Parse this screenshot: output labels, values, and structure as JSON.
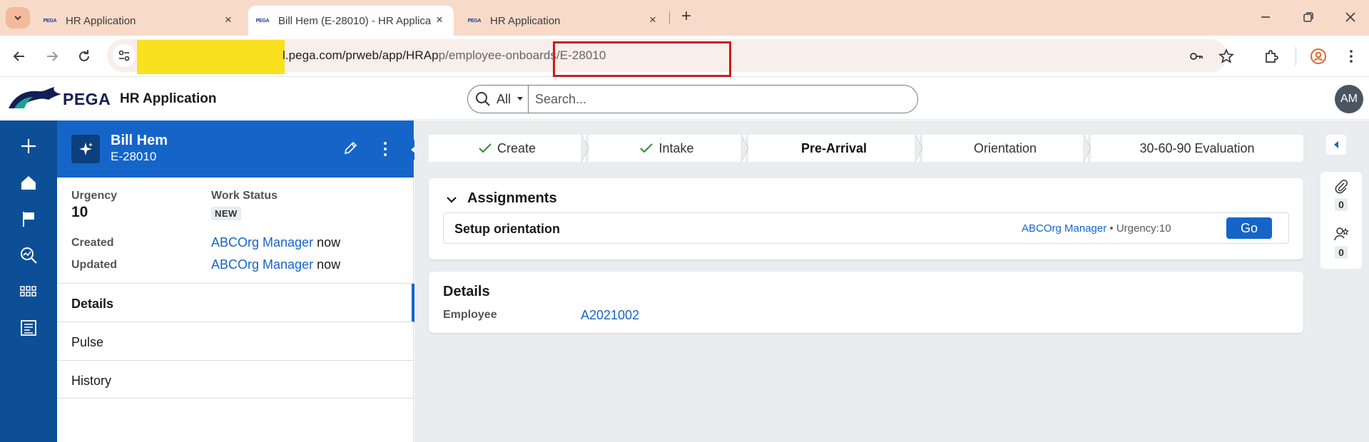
{
  "browser": {
    "tabs": [
      {
        "title": "HR Application",
        "favicon": "PEGA",
        "active": false
      },
      {
        "title": "Bill Hem (E-28010) - HR Applica",
        "favicon": "PEGA",
        "active": true
      },
      {
        "title": "HR Application",
        "favicon": "PEGA",
        "active": false
      }
    ],
    "url_visible": ".pega.com/prweb/app/HRApp/employee-onboards/E-28010",
    "url_prefix": "l.pega.com/prweb/app/HRAp",
    "url_highlighted": "p/employee-onboards/E-28010",
    "colors": {
      "tabstrip": "#f8dac9",
      "redaction": "#f9e11f",
      "highlight_box": "#d0191c",
      "profile": "#e0672b"
    }
  },
  "app": {
    "brand": "PEGA",
    "name": "HR Application",
    "search": {
      "filter": "All",
      "placeholder": "Search..."
    },
    "avatar_initials": "AM",
    "colors": {
      "primary": "#1565c8",
      "nav": "#0c4f96",
      "brand_navy": "#121f56"
    }
  },
  "leftnav": {
    "items": [
      {
        "icon": "plus-icon"
      },
      {
        "icon": "home-icon"
      },
      {
        "icon": "flag-icon"
      },
      {
        "icon": "search-analytics-icon"
      },
      {
        "icon": "apps-grid-icon"
      },
      {
        "icon": "reports-icon"
      }
    ]
  },
  "case": {
    "name": "Bill Hem",
    "id": "E-28010",
    "urgency_label": "Urgency",
    "urgency_value": "10",
    "status_label": "Work Status",
    "status_value": "NEW",
    "created_label": "Created",
    "created_by": "ABCOrg Manager",
    "created_when": "now",
    "updated_label": "Updated",
    "updated_by": "ABCOrg Manager",
    "updated_when": "now",
    "tabs": [
      "Details",
      "Pulse",
      "History"
    ]
  },
  "stages": [
    {
      "label": "Create",
      "state": "done"
    },
    {
      "label": "Intake",
      "state": "done"
    },
    {
      "label": "Pre-Arrival",
      "state": "current"
    },
    {
      "label": "Orientation",
      "state": "future"
    },
    {
      "label": "30-60-90 Evaluation",
      "state": "future"
    }
  ],
  "assignments": {
    "title": "Assignments",
    "items": [
      {
        "name": "Setup orientation",
        "assignee": "ABCOrg Manager",
        "separator": "•",
        "urgency": "Urgency:10",
        "action": "Go"
      }
    ]
  },
  "details": {
    "title": "Details",
    "employee_label": "Employee",
    "employee_value": "A2021002"
  },
  "utility_rail": {
    "attachments_count": "0",
    "followers_count": "0"
  }
}
